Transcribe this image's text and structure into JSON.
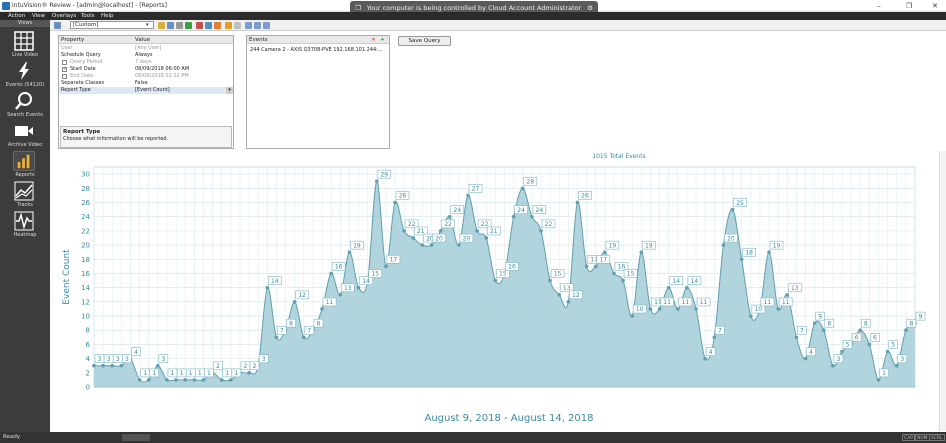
{
  "window": {
    "title": "intuVision® Review - [admin@localhost] - [Reports]",
    "controls": {
      "minimize": "–",
      "maximize": "❐",
      "close": "✕"
    }
  },
  "remote_banner": {
    "text": "Your computer is being controlled by Cloud Account Administrator"
  },
  "menu": [
    "Action",
    "View",
    "Overlays",
    "Tools",
    "Help"
  ],
  "sidebar": {
    "header": "Views",
    "items": [
      {
        "label": "Live Video",
        "icon": "grid-icon"
      },
      {
        "label": "Events (54120)",
        "icon": "lightning-icon"
      },
      {
        "label": "Search Events",
        "icon": "magnifier-icon"
      },
      {
        "label": "Archive Video",
        "icon": "video-camera-icon"
      },
      {
        "label": "Reports",
        "icon": "bar-chart-icon",
        "active": true
      },
      {
        "label": "Tracks",
        "icon": "line-graph-icon"
      },
      {
        "label": "Heatmap",
        "icon": "heatmap-icon"
      }
    ]
  },
  "toolbar": {
    "report_selector": "[Custom]"
  },
  "properties": {
    "headers": {
      "property": "Property",
      "value": "Value"
    },
    "rows": [
      {
        "name": "User",
        "value": "[Any User]",
        "gray": true
      },
      {
        "name": "Schedule Query",
        "value": "Always"
      },
      {
        "name": "Query Period",
        "value": "7 days",
        "checkbox": "",
        "gray": true
      },
      {
        "name": "Start Date",
        "value": "08/09/2018 06:00 AM",
        "checkbox": "✓"
      },
      {
        "name": "End Date",
        "value": "08/09/2018 02:32 PM",
        "checkbox": "",
        "gray": true
      },
      {
        "name": "Separate Classes",
        "value": "False"
      },
      {
        "name": "Report Type",
        "value": "[Event Count]",
        "selected": true
      }
    ],
    "help": {
      "title": "Report Type",
      "description": "Choose what information will be reported."
    }
  },
  "events_panel": {
    "header": "Events",
    "items": [
      "244 Camera 2 - AXIS Q3708-PVE 192.168.101.244:..."
    ],
    "remove_button": "✕",
    "add_button": "+"
  },
  "save_query_label": "Save Query",
  "chart_data": {
    "type": "area",
    "title": "1015 Total Events",
    "xlabel": "August  9, 2018 - August 14, 2018",
    "ylabel": "Event Count",
    "ylim": [
      0,
      31
    ],
    "yticks": [
      0,
      2,
      4,
      6,
      8,
      10,
      12,
      14,
      16,
      18,
      20,
      22,
      24,
      26,
      28,
      30
    ],
    "grid": true,
    "fill_color": "#a9cfd9",
    "line_color": "#5f9fb0",
    "label_color": "#3a8aa0",
    "values": [
      3,
      3,
      3,
      3,
      4,
      1,
      1,
      3,
      1,
      1,
      1,
      1,
      1,
      2,
      1,
      1,
      2,
      2,
      3,
      14,
      7,
      8,
      12,
      7,
      8,
      11,
      16,
      13,
      19,
      14,
      15,
      29,
      17,
      26,
      22,
      21,
      20,
      20,
      22,
      24,
      20,
      27,
      22,
      21,
      15,
      16,
      24,
      28,
      24,
      22,
      15,
      13,
      12,
      26,
      17,
      17,
      19,
      16,
      15,
      10,
      19,
      11,
      11,
      14,
      11,
      14,
      11,
      4,
      7,
      20,
      25,
      18,
      10,
      11,
      19,
      11,
      13,
      7,
      4,
      9,
      8,
      3,
      5,
      6,
      8,
      6,
      1,
      5,
      3,
      8,
      9
    ]
  },
  "status": {
    "text": "Ready",
    "indicators": [
      "CAP",
      "NUM",
      "SCRL"
    ]
  }
}
